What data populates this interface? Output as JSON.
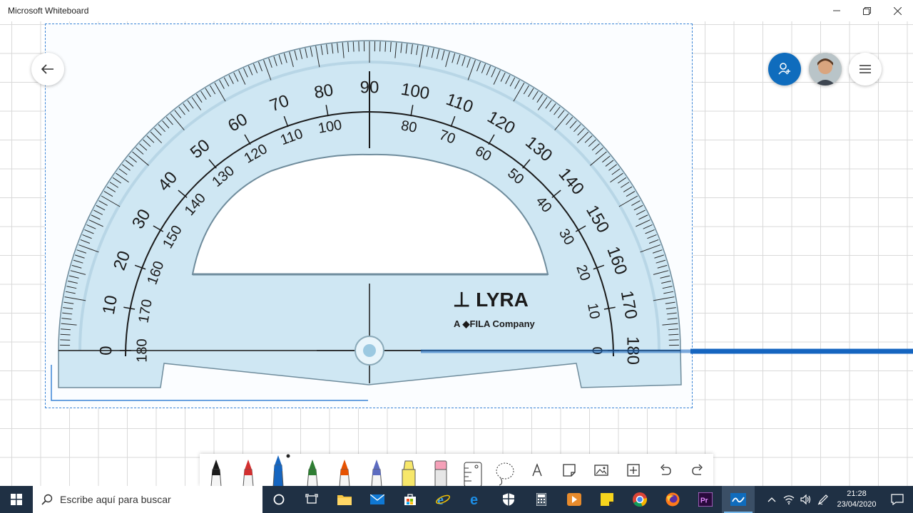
{
  "window": {
    "title": "Microsoft Whiteboard",
    "controls": [
      "minimize-icon",
      "restore-icon",
      "close-icon"
    ]
  },
  "board": {
    "back_icon": "arrow-left-icon",
    "invite_icon": "person-add-icon",
    "menu_icon": "hamburger-menu-icon",
    "protractor": {
      "outer_scale": [
        "0",
        "10",
        "20",
        "30",
        "40",
        "50",
        "60",
        "70",
        "80",
        "90",
        "100",
        "110",
        "120",
        "130",
        "140",
        "150",
        "160",
        "170",
        "180"
      ],
      "inner_scale": [
        "180",
        "170",
        "160",
        "150",
        "140",
        "130",
        "120",
        "110",
        "100",
        "80",
        "70",
        "60",
        "50",
        "40",
        "30",
        "20",
        "10",
        "0"
      ],
      "brand": "LYRA",
      "brand_sub": "A FILA Company"
    }
  },
  "toolbar": {
    "tools": [
      {
        "name": "black-pen",
        "color": "#1a1a1a"
      },
      {
        "name": "red-pen",
        "color": "#d32f2f"
      },
      {
        "name": "blue-pen",
        "color": "#1565c0",
        "selected": true
      },
      {
        "name": "green-pen",
        "color": "#2e7d32"
      },
      {
        "name": "rainbow-pen",
        "color": "#e65100"
      },
      {
        "name": "galaxy-pen",
        "color": "#5c6bc0"
      },
      {
        "name": "highlighter",
        "color": "#f7e76a"
      },
      {
        "name": "eraser",
        "color": "#f5a0b8"
      },
      {
        "name": "ruler",
        "color": "#ffffff"
      },
      {
        "name": "lasso",
        "color": "#ffffff"
      }
    ],
    "actions": [
      "text-icon",
      "note-icon",
      "image-icon",
      "insert-icon",
      "undo-icon",
      "redo-icon"
    ]
  },
  "taskbar": {
    "search_placeholder": "Escribe aquí para buscar",
    "time": "21:28",
    "date": "23/04/2020"
  }
}
